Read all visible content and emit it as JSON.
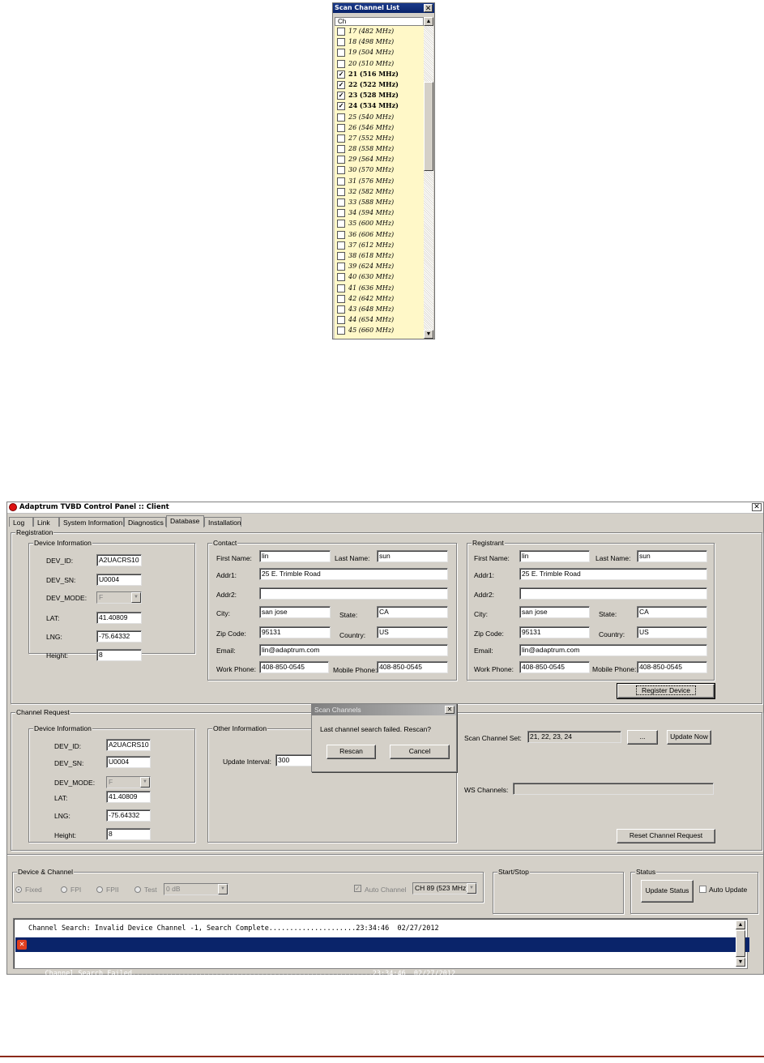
{
  "scan_list": {
    "title": "Scan Channel List",
    "close": "✕",
    "column_header": "Ch",
    "scroll_up": "▲",
    "scroll_down": "▼",
    "items": [
      {
        "label": "17 (482 MHz)",
        "checked": false
      },
      {
        "label": "18 (498 MHz)",
        "checked": false
      },
      {
        "label": "19 (504 MHz)",
        "checked": false
      },
      {
        "label": "20 (510 MHz)",
        "checked": false
      },
      {
        "label": "21 (516 MHz)",
        "checked": true
      },
      {
        "label": "22 (522 MHz)",
        "checked": true
      },
      {
        "label": "23 (528 MHz)",
        "checked": true
      },
      {
        "label": "24 (534 MHz)",
        "checked": true
      },
      {
        "label": "25 (540 MHz)",
        "checked": false
      },
      {
        "label": "26 (546 MHz)",
        "checked": false
      },
      {
        "label": "27 (552 MHz)",
        "checked": false
      },
      {
        "label": "28 (558 MHz)",
        "checked": false
      },
      {
        "label": "29 (564 MHz)",
        "checked": false
      },
      {
        "label": "30 (570 MHz)",
        "checked": false
      },
      {
        "label": "31 (576 MHz)",
        "checked": false
      },
      {
        "label": "32 (582 MHz)",
        "checked": false
      },
      {
        "label": "33 (588 MHz)",
        "checked": false
      },
      {
        "label": "34 (594 MHz)",
        "checked": false
      },
      {
        "label": "35 (600 MHz)",
        "checked": false
      },
      {
        "label": "36 (606 MHz)",
        "checked": false
      },
      {
        "label": "37 (612 MHz)",
        "checked": false
      },
      {
        "label": "38 (618 MHz)",
        "checked": false
      },
      {
        "label": "39 (624 MHz)",
        "checked": false
      },
      {
        "label": "40 (630 MHz)",
        "checked": false
      },
      {
        "label": "41 (636 MHz)",
        "checked": false
      },
      {
        "label": "42 (642 MHz)",
        "checked": false
      },
      {
        "label": "43 (648 MHz)",
        "checked": false
      },
      {
        "label": "44 (654 MHz)",
        "checked": false
      },
      {
        "label": "45 (660 MHz)",
        "checked": false
      }
    ]
  },
  "window": {
    "title": "Adaptrum TVBD Control Panel :: Client",
    "close": "✕",
    "tabs": [
      "Log",
      "Link",
      "System Information",
      "Diagnostics",
      "Database",
      "Installation"
    ],
    "active_tab": "Database"
  },
  "registration": {
    "group_label": "Registration",
    "device_info": {
      "group_label": "Device Information",
      "dev_id_label": "DEV_ID:",
      "dev_id": "A2UACRS10",
      "dev_sn_label": "DEV_SN:",
      "dev_sn": "U0004",
      "dev_mode_label": "DEV_MODE:",
      "dev_mode": "F",
      "lat_label": "LAT:",
      "lat": "41.40809",
      "lng_label": "LNG:",
      "lng": "-75.64332",
      "height_label": "Height:",
      "height": "8"
    },
    "contact": {
      "group_label": "Contact",
      "first_name_label": "First Name:",
      "first_name": "lin",
      "last_name_label": "Last Name:",
      "last_name": "sun",
      "addr1_label": "Addr1:",
      "addr1": "25 E. Trimble Road",
      "addr2_label": "Addr2:",
      "addr2": "",
      "city_label": "City:",
      "city": "san jose",
      "state_label": "State:",
      "state": "CA",
      "zip_label": "Zip Code:",
      "zip": "95131",
      "country_label": "Country:",
      "country": "US",
      "email_label": "Email:",
      "email": "lin@adaptrum.com",
      "work_phone_label": "Work Phone:",
      "work_phone": "408-850-0545",
      "mobile_phone_label": "Mobile Phone:",
      "mobile_phone": "408-850-0545"
    },
    "registrant": {
      "group_label": "Registrant",
      "first_name_label": "First Name:",
      "first_name": "lin",
      "last_name_label": "Last Name:",
      "last_name": "sun",
      "addr1_label": "Addr1:",
      "addr1": "25 E. Trimble Road",
      "addr2_label": "Addr2:",
      "addr2": "",
      "city_label": "City:",
      "city": "san jose",
      "state_label": "State:",
      "state": "CA",
      "zip_label": "Zip Code:",
      "zip": "95131",
      "country_label": "Country:",
      "country": "US",
      "email_label": "Email:",
      "email": "lin@adaptrum.com",
      "work_phone_label": "Work Phone:",
      "work_phone": "408-850-0545",
      "mobile_phone_label": "Mobile Phone:",
      "mobile_phone": "408-850-0545"
    },
    "register_button": "Register Device"
  },
  "channel_request": {
    "group_label": "Channel Request",
    "device_info": {
      "group_label": "Device Information",
      "dev_id_label": "DEV_ID:",
      "dev_id": "A2UACRS10",
      "dev_sn_label": "DEV_SN:",
      "dev_sn": "U0004",
      "dev_mode_label": "DEV_MODE:",
      "dev_mode": "F",
      "lat_label": "LAT:",
      "lat": "41.40809",
      "lng_label": "LNG:",
      "lng": "-75.64332",
      "height_label": "Height:",
      "height": "8"
    },
    "other_info": {
      "group_label": "Other Information",
      "update_interval_label": "Update Interval:",
      "update_interval": "300"
    },
    "scan_channel_set_label": "Scan Channel Set:",
    "scan_channel_set": "21, 22, 23, 24",
    "browse_button": "...",
    "update_now_button": "Update Now",
    "ws_channels_label": "WS Channels:",
    "ws_channels": "",
    "reset_button": "Reset Channel Request"
  },
  "dialog": {
    "title": "Scan Channels",
    "close": "✕",
    "message": "Last channel search failed.  Rescan?",
    "rescan_button": "Rescan",
    "cancel_button": "Cancel"
  },
  "device_channel": {
    "group_label": "Device & Channel",
    "radios": [
      "Fixed",
      "FPI",
      "FPII",
      "Test"
    ],
    "test_level": "0 dB",
    "auto_channel_label": "Auto Channel",
    "auto_channel_value": "CH 89 (523 MHz)"
  },
  "start_stop": {
    "group_label": "Start/Stop"
  },
  "status": {
    "group_label": "Status",
    "update_status_button": "Update Status",
    "auto_update_label": "Auto Update"
  },
  "log": {
    "lines": [
      {
        "text": "Channel Search: Invalid Device Channel -1, Search Complete.....................23:34:46  02/27/2012",
        "error": false
      },
      {
        "text": "Channel Search Failed..........................................................23:34:46  02/27/2012",
        "error": true
      }
    ],
    "scroll_up": "▲",
    "scroll_down": "▼"
  },
  "colors": {
    "selection": "#0a246a",
    "list_bg": "#fff8c8",
    "window_bg": "#d4d0c8",
    "footer_rule": "#8b2a1a"
  }
}
